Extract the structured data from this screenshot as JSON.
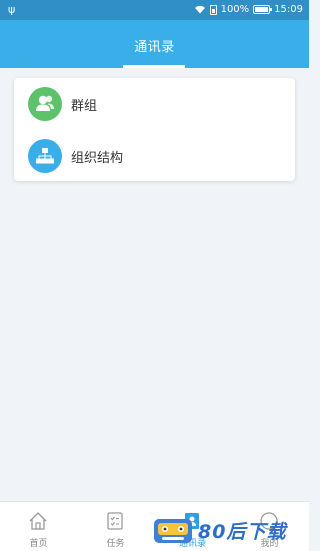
{
  "status_bar": {
    "battery": "100%",
    "time": "15:09"
  },
  "header": {
    "title": "通讯录"
  },
  "contacts": {
    "items": [
      {
        "label": "群组",
        "icon": "group-icon",
        "color": "#5ec26a"
      },
      {
        "label": "组织结构",
        "icon": "org-structure-icon",
        "color": "#3aaee8"
      }
    ]
  },
  "tabs": [
    {
      "label": "首页",
      "icon": "home-icon"
    },
    {
      "label": "任务",
      "icon": "task-icon"
    },
    {
      "label": "通讯录",
      "icon": "contacts-icon",
      "active": true
    },
    {
      "label": "我的",
      "icon": "profile-icon"
    }
  ],
  "watermark": {
    "text": "80后下载"
  },
  "colors": {
    "accent": "#3aaee8",
    "status_bar": "#2f8fc6",
    "background": "#f0f3f7"
  }
}
